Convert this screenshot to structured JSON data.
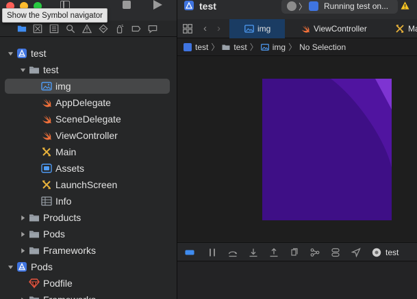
{
  "tooltip": {
    "text": "Show the Symbol navigator"
  },
  "navigator": {
    "tabs": [
      {
        "name": "project-navigator-tab",
        "icon": "folder-icon",
        "active": true
      },
      {
        "name": "source-control-navigator-tab",
        "icon": "source-control-icon"
      },
      {
        "name": "symbol-navigator-tab",
        "icon": "symbol-icon"
      },
      {
        "name": "find-navigator-tab",
        "icon": "search-icon"
      },
      {
        "name": "issue-navigator-tab",
        "icon": "warning-icon"
      },
      {
        "name": "test-navigator-tab",
        "icon": "test-diamond-icon"
      },
      {
        "name": "debug-navigator-tab",
        "icon": "spray-can-icon"
      },
      {
        "name": "breakpoint-navigator-tab",
        "icon": "breakpoint-icon"
      },
      {
        "name": "report-navigator-tab",
        "icon": "report-icon"
      }
    ],
    "tree": [
      {
        "label": "test",
        "icon": "project-icon",
        "depth": 0,
        "disclosure": "open"
      },
      {
        "label": "test",
        "icon": "folder-icon",
        "depth": 1,
        "disclosure": "open"
      },
      {
        "label": "img",
        "icon": "image-icon",
        "depth": 2,
        "disclosure": "none",
        "selected": true
      },
      {
        "label": "AppDelegate",
        "icon": "swift-icon",
        "depth": 2,
        "disclosure": "none"
      },
      {
        "label": "SceneDelegate",
        "icon": "swift-icon",
        "depth": 2,
        "disclosure": "none"
      },
      {
        "label": "ViewController",
        "icon": "swift-icon",
        "depth": 2,
        "disclosure": "none"
      },
      {
        "label": "Main",
        "icon": "storyboard-icon",
        "depth": 2,
        "disclosure": "none"
      },
      {
        "label": "Assets",
        "icon": "asset-catalog-icon",
        "depth": 2,
        "disclosure": "none"
      },
      {
        "label": "LaunchScreen",
        "icon": "storyboard-icon",
        "depth": 2,
        "disclosure": "none"
      },
      {
        "label": "Info",
        "icon": "plist-icon",
        "depth": 2,
        "disclosure": "none"
      },
      {
        "label": "Products",
        "icon": "folder-icon",
        "depth": 1,
        "disclosure": "closed"
      },
      {
        "label": "Pods",
        "icon": "folder-icon",
        "depth": 1,
        "disclosure": "closed"
      },
      {
        "label": "Frameworks",
        "icon": "folder-icon",
        "depth": 1,
        "disclosure": "closed"
      },
      {
        "label": "Pods",
        "icon": "project-icon",
        "depth": 0,
        "disclosure": "open"
      },
      {
        "label": "Podfile",
        "icon": "ruby-icon",
        "depth": 1,
        "disclosure": "none"
      },
      {
        "label": "Frameworks",
        "icon": "folder-icon",
        "depth": 1,
        "disclosure": "closed"
      }
    ]
  },
  "toolbar": {
    "project_name": "test",
    "status_text": "Running test on...",
    "scheme_icon": "scheme-icon",
    "warning_icon": "warning-icon"
  },
  "editor": {
    "tabs": [
      {
        "label": "img",
        "icon": "image-icon",
        "active": true
      },
      {
        "label": "ViewController",
        "icon": "swift-icon"
      },
      {
        "label": "Ma",
        "icon": "storyboard-icon"
      }
    ],
    "breadcrumb": {
      "items": [
        "test",
        "test",
        "img"
      ],
      "selection": "No Selection"
    }
  },
  "debug_bar": {
    "target_label": "test"
  },
  "colors": {
    "accent": "#3f74e0",
    "swift": "#f0703a",
    "storyboard": "#e8b23b",
    "image_dark": "#3e0f86",
    "image_mid": "#5014a0",
    "image_light": "#7e34d2"
  }
}
